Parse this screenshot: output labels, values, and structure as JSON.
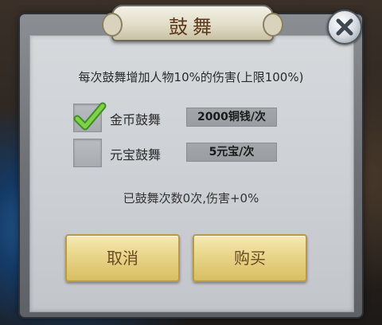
{
  "dialog": {
    "title": "鼓舞",
    "description": "每次鼓舞增加人物10%的伤害(上限100%)",
    "options": [
      {
        "label": "金币鼓舞",
        "price": "2000铜钱/次",
        "checked": true
      },
      {
        "label": "元宝鼓舞",
        "price": "5元宝/次",
        "checked": false
      }
    ],
    "status": "已鼓舞次数0次,伤害+0%",
    "cancel_label": "取消",
    "buy_label": "购买"
  },
  "colors": {
    "checkmark": "#5fb83a",
    "button_gold": "#e9d58a",
    "panel": "#cbcfd3"
  },
  "icons": {
    "close": "close-icon",
    "check": "checkmark-icon"
  }
}
